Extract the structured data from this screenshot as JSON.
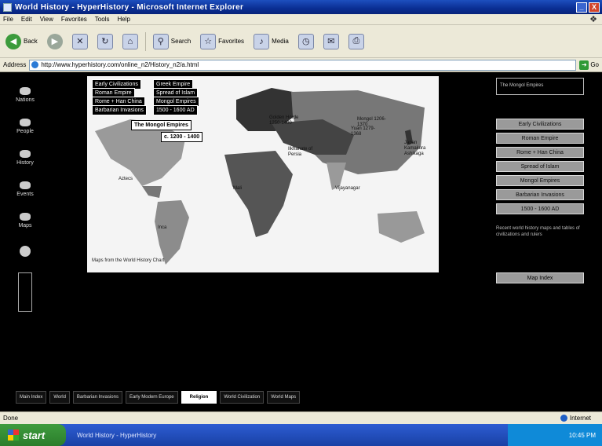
{
  "window": {
    "title": "World History - HyperHistory - Microsoft Internet Explorer",
    "minimize": "_",
    "close": "X"
  },
  "menu": {
    "items": [
      "File",
      "Edit",
      "View",
      "Favorites",
      "Tools",
      "Help"
    ]
  },
  "toolbar": {
    "back_label": "Back",
    "search_label": "Search",
    "favorites_label": "Favorites",
    "media_label": "Media"
  },
  "address": {
    "label": "Address",
    "url": "http://www.hyperhistory.com/online_n2/History_n2/a.html",
    "go_label": "Go"
  },
  "left_nav": {
    "items": [
      "Nations",
      "People",
      "History",
      "Events",
      "Maps"
    ]
  },
  "map": {
    "buttons_left": [
      "Early Civilizations",
      "Roman Empire",
      "Rome + Han China",
      "Barbarian Invasions"
    ],
    "buttons_right": [
      "Greek Empire",
      "Spread of Islam",
      "Mongol Empires",
      "1500 - 1600 AD"
    ],
    "highlight_title": "The Mongol Empires",
    "highlight_period": "c. 1200 - 1400",
    "labels": {
      "golden_horde": "Golden Horde 1250-1400",
      "mongol": "Mongol 1206-1370",
      "yuan": "Yuan 1279-1368",
      "ilkhanate": "Ilkhanate of Persia",
      "japan": "Japan Kamakura Ashikaga",
      "vijayanagar": "Vijayanagar",
      "mali": "Mali",
      "aztecs": "Aztecs",
      "inca": "Inca"
    },
    "credit": "Maps from the World History Chart"
  },
  "right_panel": {
    "top_text": "The Mongol Empires",
    "buttons": [
      "Early Civilizations",
      "Roman Empire",
      "Rome + Han China",
      "Spread of Islam",
      "Mongol Empires",
      "Barbarian Invasions",
      "1500 - 1600 AD"
    ],
    "note": "Recent world history maps and tables of civilizations and rulers",
    "single_button": "Map Index"
  },
  "bottom_strip": {
    "items": [
      "Main Index",
      "World",
      "Barbarian Invasions",
      "Early Modern Europe",
      "Religion",
      "World Civilization",
      "World Maps"
    ],
    "active_index": 4
  },
  "status": {
    "left": "Done",
    "zone": "Internet"
  },
  "taskbar": {
    "start": "start",
    "task": "World History - HyperHistory",
    "clock": "10:45 PM"
  }
}
